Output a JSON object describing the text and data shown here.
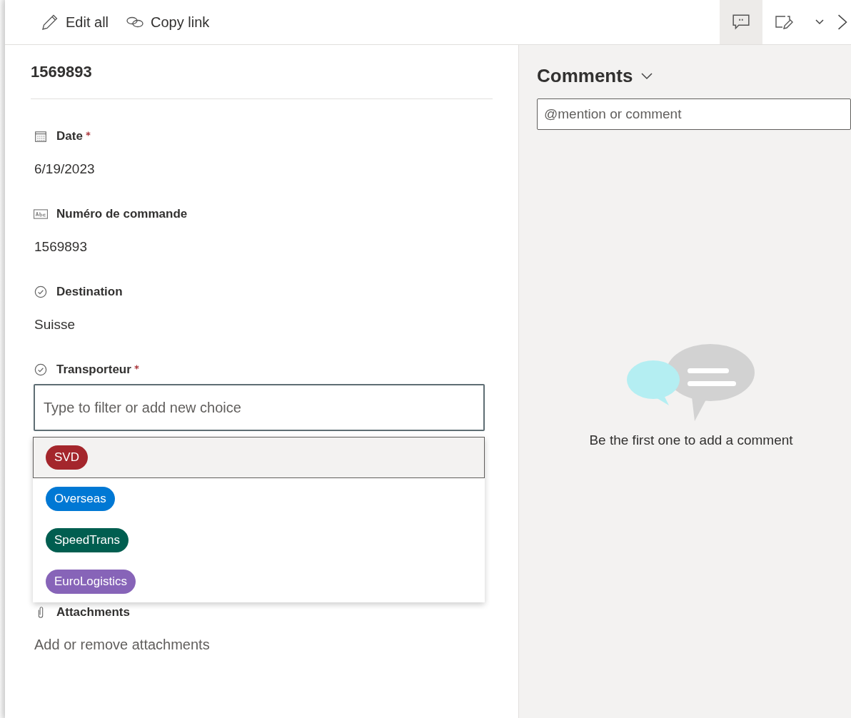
{
  "toolbar": {
    "actions": [
      {
        "kind": "edit",
        "label": "Edit all"
      },
      {
        "kind": "link",
        "label": "Copy link"
      }
    ],
    "right_buttons": [
      {
        "kind": "comments",
        "selected": true
      },
      {
        "kind": "form",
        "selected": false
      },
      {
        "kind": "chevron",
        "selected": false
      },
      {
        "kind": "close",
        "selected": false
      }
    ]
  },
  "title": "1569893",
  "fields": [
    {
      "kind": "date",
      "label": "Date",
      "required": true,
      "value": "6/19/2023"
    },
    {
      "kind": "text",
      "label": "Numéro de commande",
      "required": false,
      "value": "1569893"
    },
    {
      "kind": "choice",
      "label": "Destination",
      "required": false,
      "value": "Suisse"
    },
    {
      "kind": "choice",
      "label": "Transporteur",
      "required": true,
      "placeholder": "Type to filter or add new choice"
    }
  ],
  "choices": [
    {
      "label": "SVD",
      "color": "#a4262c",
      "selected": true
    },
    {
      "label": "Overseas",
      "color": "#0078d4",
      "selected": false
    },
    {
      "label": "SpeedTrans",
      "color": "#005e50",
      "selected": false
    },
    {
      "label": "EuroLogistics",
      "color": "#8764b8",
      "selected": false
    }
  ],
  "attachments": {
    "label": "Attachments",
    "value": "Add or remove attachments"
  },
  "comments": {
    "title": "Comments",
    "placeholder": "@mention or comment",
    "empty_text": "Be the first one to add a comment"
  }
}
